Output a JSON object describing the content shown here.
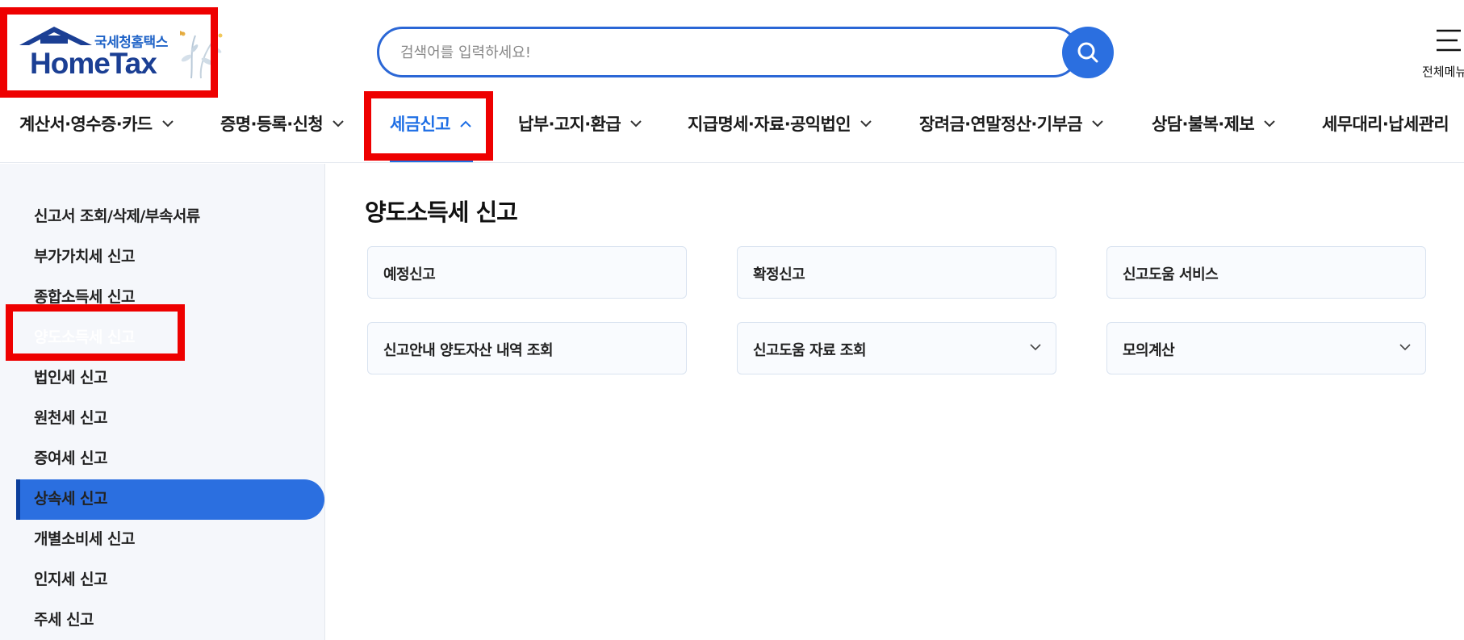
{
  "header": {
    "logo_sub": "국세청홈택스",
    "logo_main": "HomeTax",
    "search_placeholder": "검색어를 입력하세요!",
    "allmenu_label": "전체메뉴"
  },
  "nav": {
    "items": [
      {
        "label": "계산서·영수증·카드"
      },
      {
        "label": "증명·등록·신청"
      },
      {
        "label": "세금신고",
        "active": true
      },
      {
        "label": "납부·고지·환급"
      },
      {
        "label": "지급명세·자료·공익법인"
      },
      {
        "label": "장려금·연말정산·기부금"
      },
      {
        "label": "상담·불복·제보"
      },
      {
        "label": "세무대리·납세관리"
      }
    ]
  },
  "sidebar": {
    "items": [
      {
        "label": "신고서 조회/삭제/부속서류"
      },
      {
        "label": "부가가치세 신고"
      },
      {
        "label": "종합소득세 신고"
      },
      {
        "label": "양도소득세 신고",
        "active": true
      },
      {
        "label": "법인세 신고"
      },
      {
        "label": "원천세 신고"
      },
      {
        "label": "증여세 신고"
      },
      {
        "label": "상속세 신고"
      },
      {
        "label": "개별소비세 신고"
      },
      {
        "label": "인지세 신고"
      },
      {
        "label": "주세 신고"
      }
    ]
  },
  "main": {
    "title": "양도소득세 신고",
    "cards": [
      {
        "label": "예정신고",
        "dropdown": false
      },
      {
        "label": "확정신고",
        "dropdown": false
      },
      {
        "label": "신고도움 서비스",
        "dropdown": false
      },
      {
        "label": "신고안내 양도자산 내역 조회",
        "dropdown": false
      },
      {
        "label": "신고도움 자료 조회",
        "dropdown": true
      },
      {
        "label": "모의계산",
        "dropdown": true
      }
    ]
  },
  "colors": {
    "accent": "#2b6fe0",
    "active_text": "#1f6fe5",
    "highlight": "#ee0000",
    "sidebar_bg": "#f5f7fb"
  }
}
